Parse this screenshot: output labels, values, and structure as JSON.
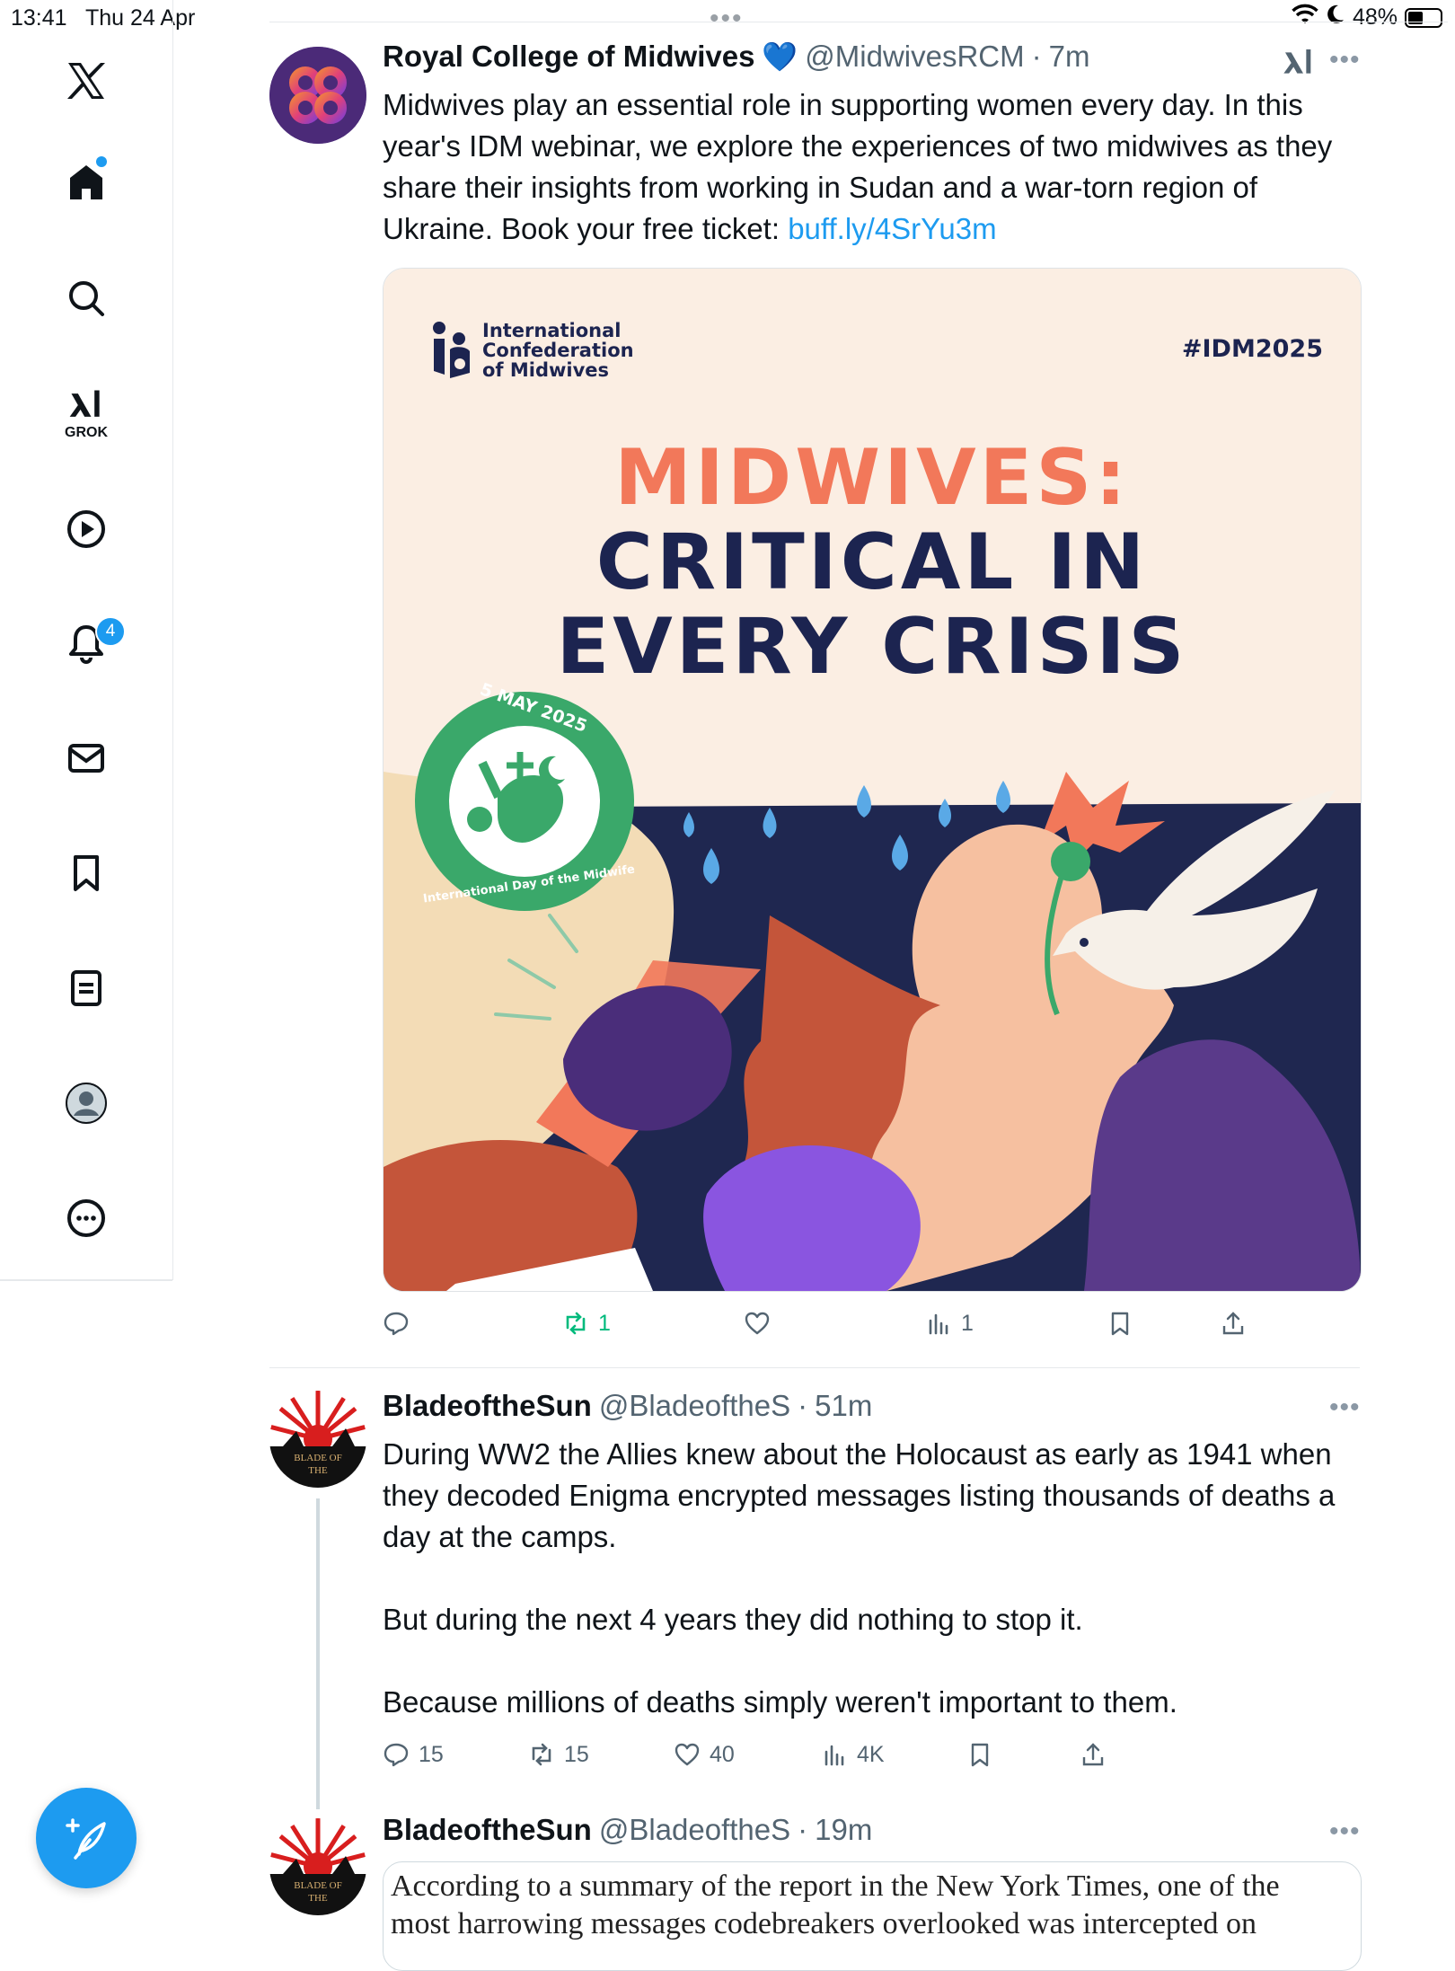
{
  "status_bar": {
    "time": "13:41",
    "date": "Thu 24 Apr",
    "battery": "48%",
    "battery_level": 0.48
  },
  "sidebar": {
    "items": [
      {
        "name": "x-logo",
        "icon": "x-logo-icon"
      },
      {
        "name": "home",
        "icon": "home-icon"
      },
      {
        "name": "explore",
        "icon": "search-icon"
      },
      {
        "name": "grok",
        "icon": "grok-icon",
        "label": "GROK"
      },
      {
        "name": "video",
        "icon": "play-icon"
      },
      {
        "name": "notifications",
        "icon": "bell-icon",
        "badge": "4"
      },
      {
        "name": "messages",
        "icon": "mail-icon"
      },
      {
        "name": "bookmarks",
        "icon": "bookmark-icon"
      },
      {
        "name": "lists",
        "icon": "list-icon"
      },
      {
        "name": "profile",
        "icon": "profile-icon"
      },
      {
        "name": "more",
        "icon": "more-circle-icon"
      }
    ]
  },
  "tweets": [
    {
      "name": "Royal College of Midwives",
      "verified_emoji": "💙",
      "handle": "@MidwivesRCM",
      "sep": "·",
      "time": "7m",
      "text": "Midwives play an essential role in supporting women every day. In this year's IDM webinar, we explore the experiences of two midwives as they share their insights from working in Sudan and a war-torn region of Ukraine. Book your free ticket: ",
      "link": "buff.ly/4SrYu3m",
      "media": {
        "org_line1": "International",
        "org_line2": "Confederation",
        "org_line3": "of Midwives",
        "hashtag": "#IDM2025",
        "headline1": "MIDWIVES:",
        "headline2": "CRITICAL IN",
        "headline3": "EVERY CRISIS",
        "seal_date": "5 MAY 2025",
        "seal_text": "International Day of the Midwife"
      },
      "actions": {
        "reply": "",
        "retweet": "1",
        "like": "",
        "views": "1"
      }
    },
    {
      "name": "BladeoftheSun",
      "handle": "@BladeoftheS",
      "sep": "·",
      "time": "51m",
      "para1": "During WW2 the Allies knew about the Holocaust as early as 1941 when they decoded Enigma encrypted messages listing thousands of deaths a day at the camps.",
      "para2": "But during the next 4 years they did nothing to stop it.",
      "para3": "Because millions of deaths simply weren't important to them.",
      "actions": {
        "reply": "15",
        "retweet": "15",
        "like": "40",
        "views": "4K"
      },
      "avatar_text": "BLADE OF THE"
    },
    {
      "name": "BladeoftheSun",
      "handle": "@BladeoftheS",
      "sep": "·",
      "time": "19m",
      "quote_text": "According to a summary of the report in the New York Times, one of the most harrowing messages codebreakers overlooked was intercepted on",
      "avatar_text": "BLADE OF THE"
    }
  ],
  "colors": {
    "accent": "#1d9bf0",
    "retweet_active": "#00ba7c",
    "navy": "#1c2450",
    "coral": "#f2785a",
    "seal_green": "#3aa86a"
  }
}
